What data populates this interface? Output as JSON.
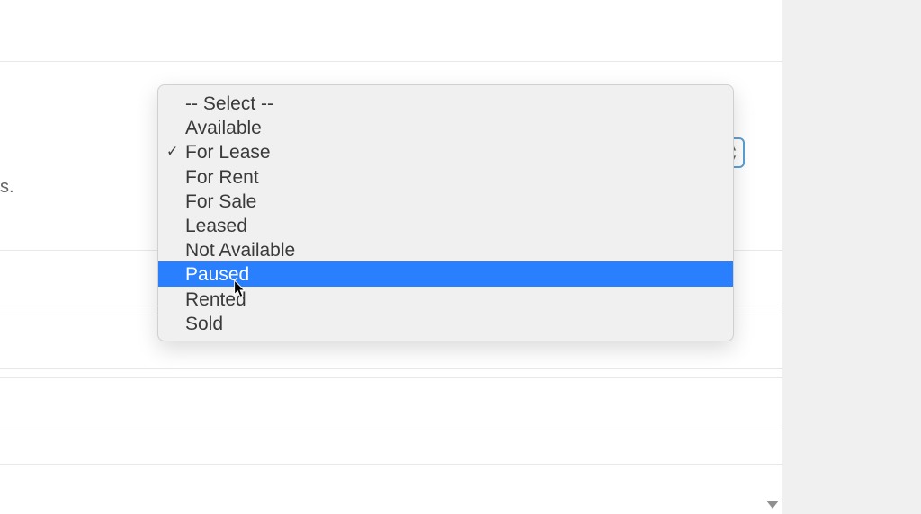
{
  "dropdown": {
    "placeholder_label": "-- Select --",
    "selected_value": "For Lease",
    "highlighted_value": "Paused",
    "options": [
      {
        "label": "Available",
        "checked": false,
        "highlighted": false
      },
      {
        "label": "For Lease",
        "checked": true,
        "highlighted": false
      },
      {
        "label": "For Rent",
        "checked": false,
        "highlighted": false
      },
      {
        "label": "For Sale",
        "checked": false,
        "highlighted": false
      },
      {
        "label": "Leased",
        "checked": false,
        "highlighted": false
      },
      {
        "label": "Not Available",
        "checked": false,
        "highlighted": false
      },
      {
        "label": "Paused",
        "checked": false,
        "highlighted": true
      },
      {
        "label": "Rented",
        "checked": false,
        "highlighted": false
      },
      {
        "label": "Sold",
        "checked": false,
        "highlighted": false
      }
    ]
  },
  "background": {
    "partial_text": "s."
  },
  "colors": {
    "highlight": "#2a7fff",
    "menu_background": "#f0f0f0",
    "text": "#3a3a3a",
    "select_border": "#5a9fd4"
  }
}
